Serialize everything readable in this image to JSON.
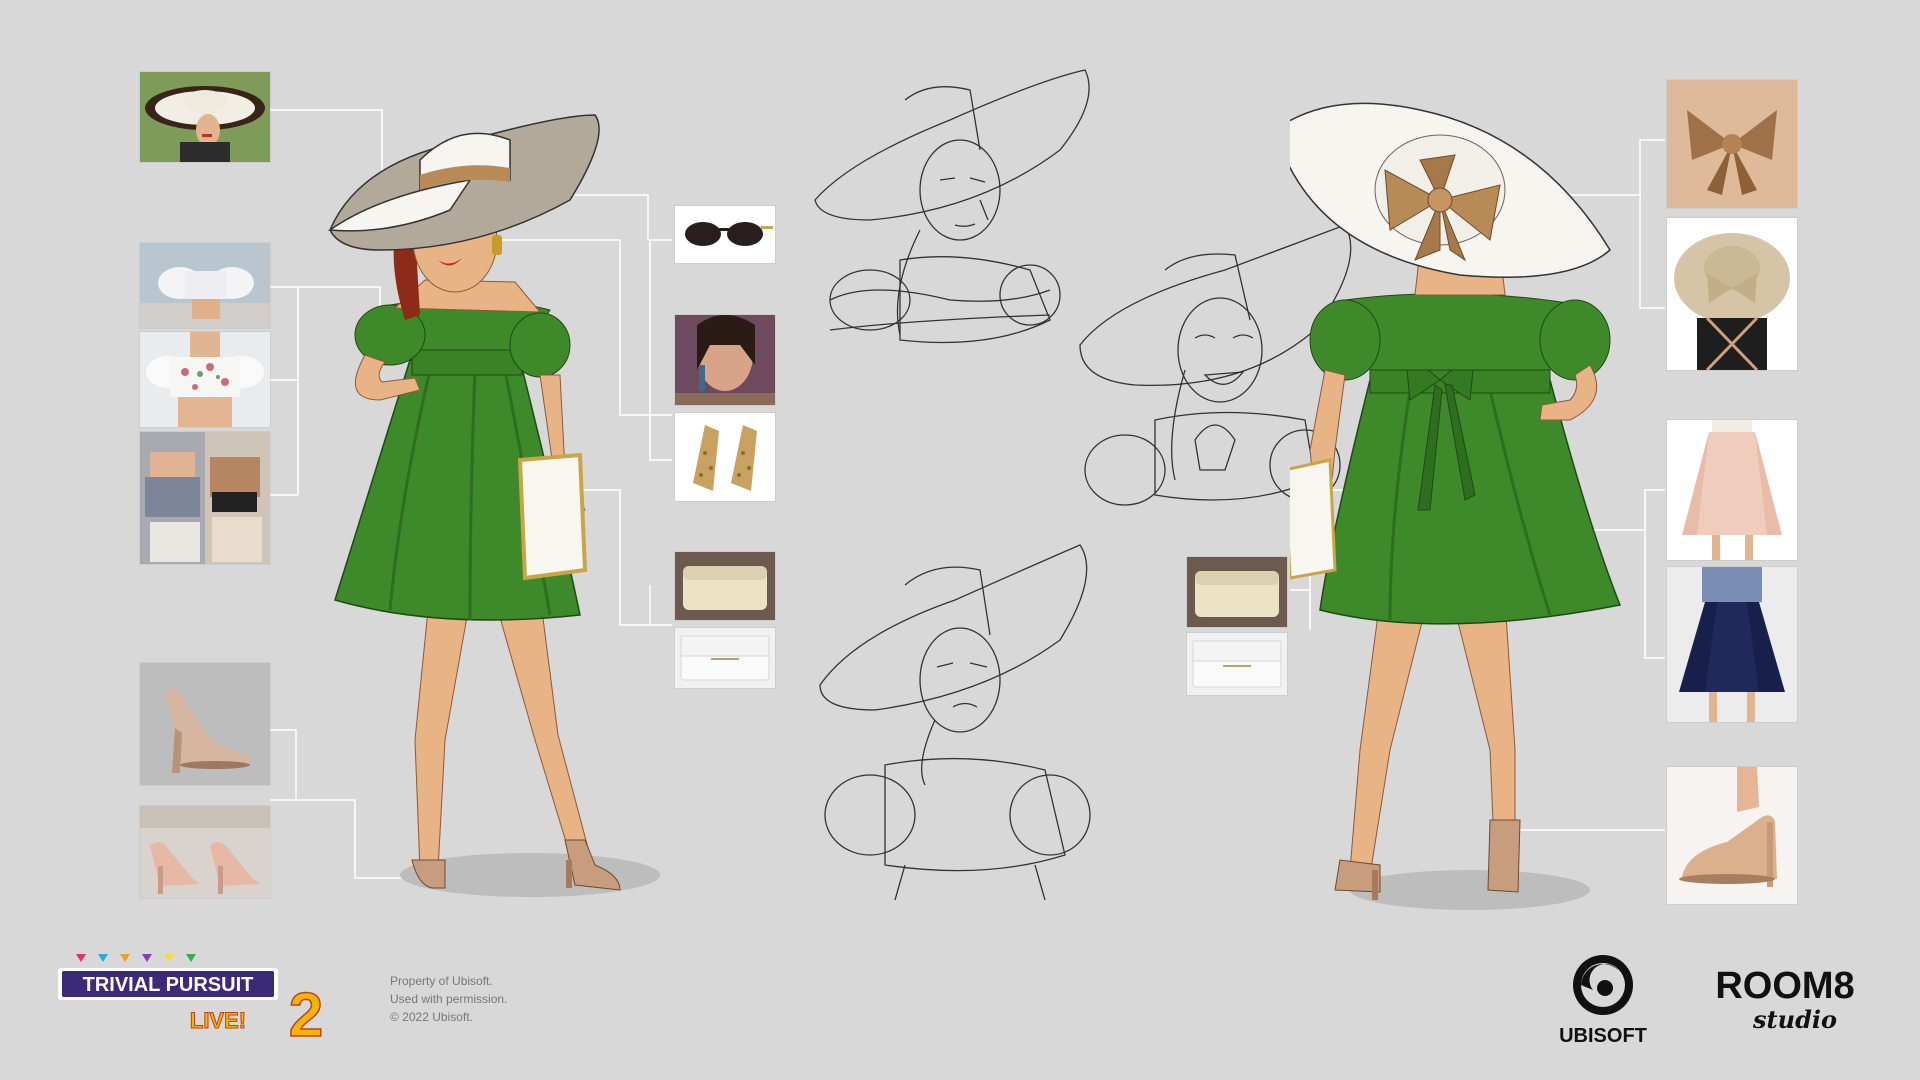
{
  "footer": {
    "copyright_lines": [
      "Property of Ubisoft.",
      "Used with permission.",
      "© 2022 Ubisoft."
    ]
  },
  "logos": {
    "trivial_word1": "TRIVIAL PURSUIT",
    "trivial_word2": "LIVE!",
    "trivial_number": "2",
    "ubisoft": "UBISOFT",
    "room8_main": "ROOM8",
    "room8_sub": "studio"
  },
  "colors": {
    "background": "#d8d8d8",
    "dress_green": "#3e8a2a",
    "dress_shadow": "#2f6e1f",
    "skin": "#e8b485",
    "hat_white": "#f7f5f0",
    "hat_under": "#b3a99a",
    "bow_tan": "#b88a55",
    "shoe_nude": "#c79d7e",
    "connector": "#ffffff"
  },
  "reference_icons": [
    "hat-photo-icon",
    "blouse-photo-icon",
    "floral-top-photo-icon",
    "offshoulder-tops-photo-icon",
    "nude-heels-photo-icon",
    "pink-heels-photo-icon",
    "sunglasses-photo-icon",
    "earring-model-photo-icon",
    "gold-earrings-photo-icon",
    "beige-clutch-photo-icon",
    "white-clutch-photo-icon",
    "ribbon-bow-photo-icon",
    "straw-hat-bow-photo-icon",
    "pink-skirt-photo-icon",
    "navy-skirt-photo-icon",
    "nude-pump-photo-icon"
  ]
}
